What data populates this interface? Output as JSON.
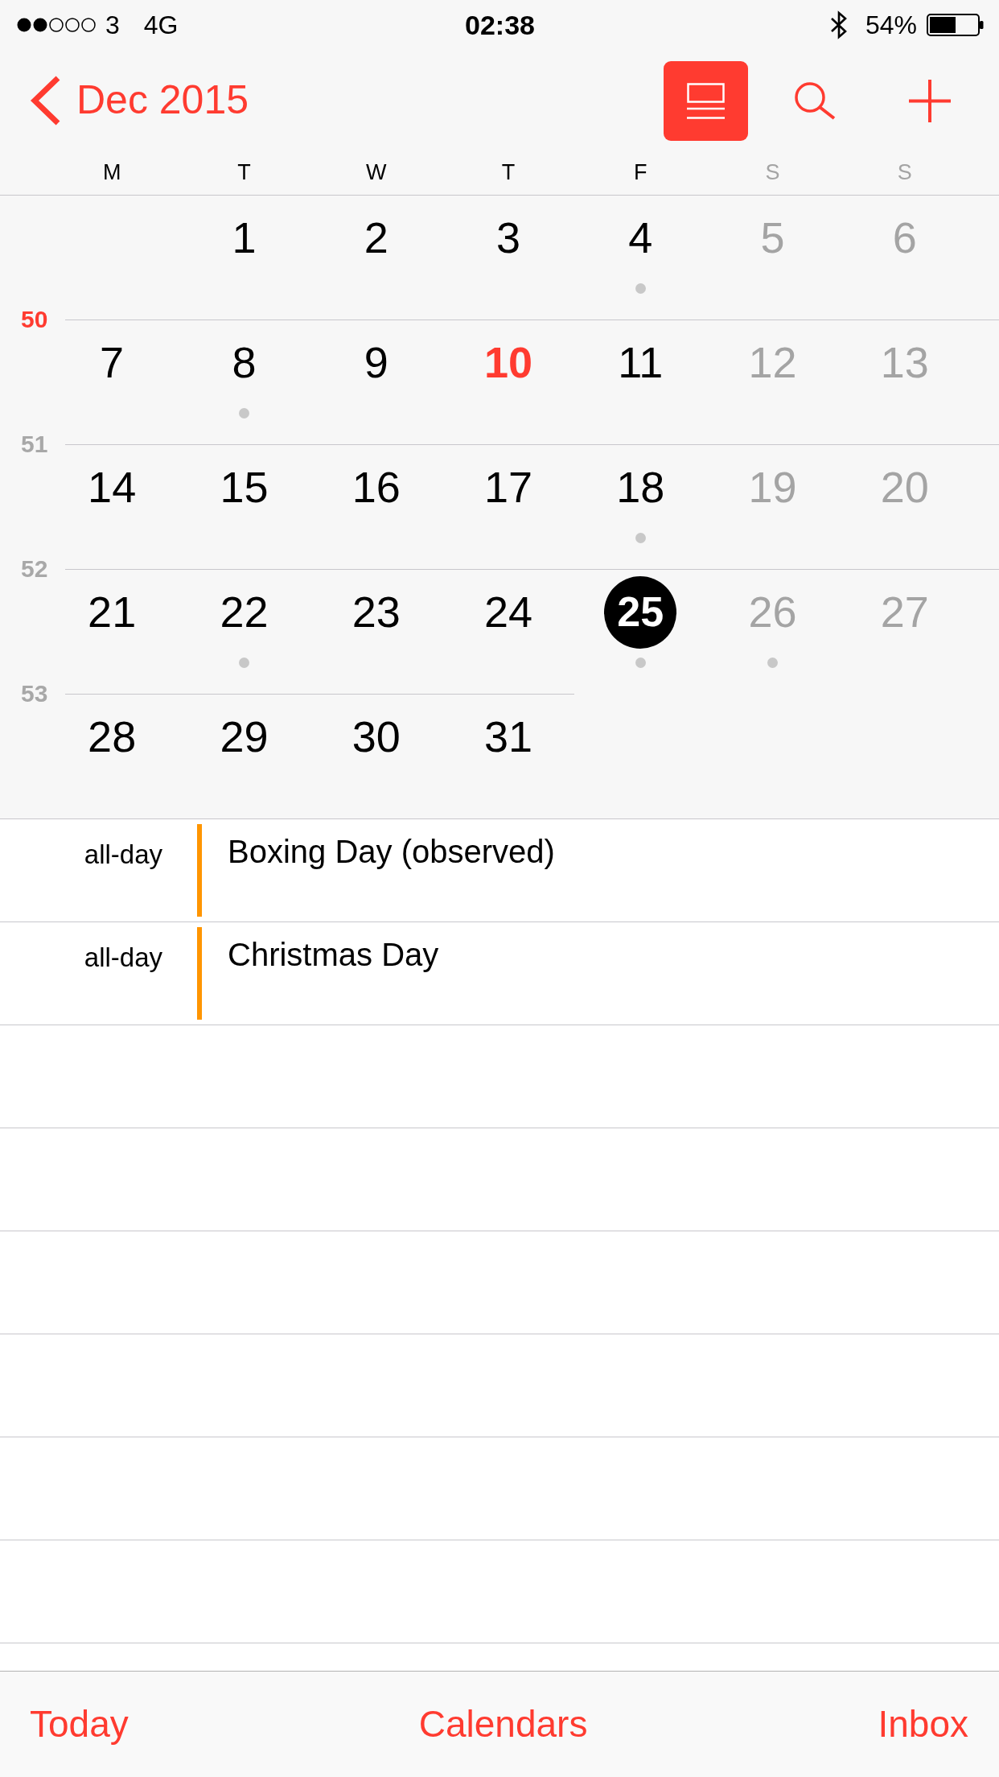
{
  "status_bar": {
    "carrier": "3",
    "network": "4G",
    "time": "02:38",
    "battery": "54%"
  },
  "nav_bar": {
    "back_label": "Dec 2015",
    "view_toggle": {
      "on": true
    }
  },
  "weekdays": [
    {
      "label": "M",
      "weekend": false
    },
    {
      "label": "T",
      "weekend": false
    },
    {
      "label": "W",
      "weekend": false
    },
    {
      "label": "T",
      "weekend": false
    },
    {
      "label": "F",
      "weekend": false
    },
    {
      "label": "S",
      "weekend": true
    },
    {
      "label": "S",
      "weekend": true
    }
  ],
  "weeks": [
    {
      "days": [
        {
          "kind": "empty"
        },
        {
          "kind": "day",
          "label": "1",
          "weekend": false,
          "today": false,
          "selected": false,
          "has_events": false
        },
        {
          "kind": "day",
          "label": "2",
          "weekend": false,
          "today": false,
          "selected": false,
          "has_events": false
        },
        {
          "kind": "day",
          "label": "3",
          "weekend": false,
          "today": false,
          "selected": false,
          "has_events": false
        },
        {
          "kind": "day",
          "label": "4",
          "weekend": false,
          "today": false,
          "selected": false,
          "has_events": true
        },
        {
          "kind": "day",
          "label": "5",
          "weekend": true,
          "today": false,
          "selected": false,
          "has_events": false
        },
        {
          "kind": "day",
          "label": "6",
          "weekend": true,
          "today": false,
          "selected": false,
          "has_events": false
        }
      ]
    },
    {
      "number": "50",
      "current": true,
      "days": [
        {
          "kind": "day",
          "label": "7",
          "weekend": false,
          "today": false,
          "selected": false,
          "has_events": false
        },
        {
          "kind": "day",
          "label": "8",
          "weekend": false,
          "today": false,
          "selected": false,
          "has_events": true
        },
        {
          "kind": "day",
          "label": "9",
          "weekend": false,
          "today": false,
          "selected": false,
          "has_events": false
        },
        {
          "kind": "day",
          "label": "10",
          "weekend": false,
          "today": true,
          "selected": false,
          "has_events": false
        },
        {
          "kind": "day",
          "label": "11",
          "weekend": false,
          "today": false,
          "selected": false,
          "has_events": false
        },
        {
          "kind": "day",
          "label": "12",
          "weekend": true,
          "today": false,
          "selected": false,
          "has_events": false
        },
        {
          "kind": "day",
          "label": "13",
          "weekend": true,
          "today": false,
          "selected": false,
          "has_events": false
        }
      ]
    },
    {
      "number": "51",
      "current": false,
      "days": [
        {
          "kind": "day",
          "label": "14",
          "weekend": false,
          "today": false,
          "selected": false,
          "has_events": false
        },
        {
          "kind": "day",
          "label": "15",
          "weekend": false,
          "today": false,
          "selected": false,
          "has_events": false
        },
        {
          "kind": "day",
          "label": "16",
          "weekend": false,
          "today": false,
          "selected": false,
          "has_events": false
        },
        {
          "kind": "day",
          "label": "17",
          "weekend": false,
          "today": false,
          "selected": false,
          "has_events": false
        },
        {
          "kind": "day",
          "label": "18",
          "weekend": false,
          "today": false,
          "selected": false,
          "has_events": true
        },
        {
          "kind": "day",
          "label": "19",
          "weekend": true,
          "today": false,
          "selected": false,
          "has_events": false
        },
        {
          "kind": "day",
          "label": "20",
          "weekend": true,
          "today": false,
          "selected": false,
          "has_events": false
        }
      ]
    },
    {
      "number": "52",
      "current": false,
      "days": [
        {
          "kind": "day",
          "label": "21",
          "weekend": false,
          "today": false,
          "selected": false,
          "has_events": false
        },
        {
          "kind": "day",
          "label": "22",
          "weekend": false,
          "today": false,
          "selected": false,
          "has_events": true
        },
        {
          "kind": "day",
          "label": "23",
          "weekend": false,
          "today": false,
          "selected": false,
          "has_events": false
        },
        {
          "kind": "day",
          "label": "24",
          "weekend": false,
          "today": false,
          "selected": false,
          "has_events": false
        },
        {
          "kind": "day",
          "label": "25",
          "weekend": false,
          "today": false,
          "selected": true,
          "has_events": true
        },
        {
          "kind": "day",
          "label": "26",
          "weekend": true,
          "today": false,
          "selected": false,
          "has_events": true
        },
        {
          "kind": "day",
          "label": "27",
          "weekend": true,
          "today": false,
          "selected": false,
          "has_events": false
        }
      ]
    },
    {
      "number": "53",
      "current": false,
      "days": [
        {
          "kind": "day",
          "label": "28",
          "weekend": false,
          "today": false,
          "selected": false,
          "has_events": false
        },
        {
          "kind": "day",
          "label": "29",
          "weekend": false,
          "today": false,
          "selected": false,
          "has_events": false
        },
        {
          "kind": "day",
          "label": "30",
          "weekend": false,
          "today": false,
          "selected": false,
          "has_events": false
        },
        {
          "kind": "day",
          "label": "31",
          "weekend": false,
          "today": false,
          "selected": false,
          "has_events": false
        }
      ]
    }
  ],
  "events": [
    {
      "time": "all-day",
      "title": "Boxing Day (observed)",
      "color": "#ff9500"
    },
    {
      "time": "all-day",
      "title": "Christmas Day",
      "color": "#ff9500"
    }
  ],
  "toolbar": {
    "items": [
      "Today",
      "Calendars",
      "Inbox"
    ]
  }
}
